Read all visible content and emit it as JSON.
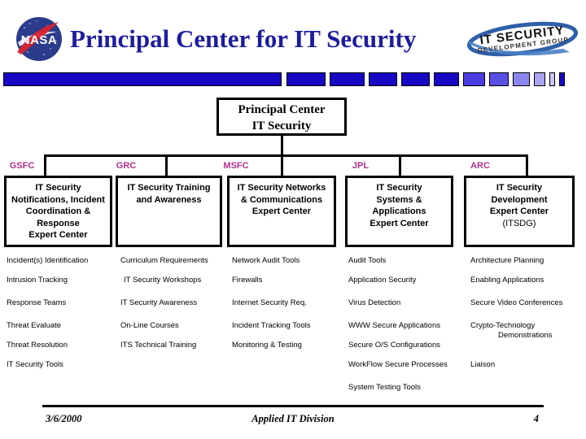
{
  "header": {
    "title": "Principal Center for IT Security",
    "title_color": "#1d1d9e",
    "nasa_logo_alt": "NASA",
    "itsdg_logo_line1": "IT SECURITY",
    "itsdg_logo_line2": "DEVELOPMENT GROUP"
  },
  "accent_bar": {
    "colors": [
      "#1708c4",
      "#1708c4",
      "#1708c4",
      "#1708c4",
      "#1708c4",
      "#1708c4",
      "#4a3ce0",
      "#5a4fe3",
      "#8b86ee",
      "#a9a5f3",
      "#c9c6f8",
      "#1708c4"
    ]
  },
  "chart": {
    "root": {
      "line1": "Principal Center",
      "line2": "IT Security"
    },
    "centers": [
      {
        "code": "GSFC",
        "unit_lines": [
          "IT Security",
          "Notifications, Incident",
          "Coordination &",
          "Response",
          "Expert Center"
        ],
        "unit_sub": "",
        "items": [
          "Incident(s) Identification",
          "Intrusion Tracking",
          "Response  Teams",
          "Threat Evaluate",
          "Threat Resolution",
          "IT Security Tools"
        ]
      },
      {
        "code": "GRC",
        "unit_lines": [
          "IT Security Training",
          "and Awareness"
        ],
        "unit_sub": "",
        "items": [
          "Curriculum Requirements",
          "IT Security Workshops",
          "IT Security Awareness",
          "On-Line Courses",
          "ITS Technical Training"
        ]
      },
      {
        "code": "MSFC",
        "unit_lines": [
          "IT Security Networks",
          "& Communications",
          "Expert Center"
        ],
        "unit_sub": "",
        "items": [
          "Network Audit Tools",
          "Firewalls",
          "Internet Security Req.",
          "Incident Tracking Tools",
          "Monitoring & Testing"
        ]
      },
      {
        "code": "JPL",
        "unit_lines": [
          "IT Security",
          "Systems &",
          "Applications",
          "Expert Center"
        ],
        "unit_sub": "",
        "items": [
          "Audit Tools",
          "Application Security",
          "Virus Detection",
          "WWW Secure Applications",
          "Secure O/S Configurations",
          "WorkFlow Secure Processes",
          "System Testing Tools"
        ]
      },
      {
        "code": "ARC",
        "unit_lines": [
          "IT Security",
          "Development",
          "Expert Center"
        ],
        "unit_sub": "(ITSDG)",
        "items": [
          "Architecture Planning",
          "Enabling Applications",
          "Secure Video Conferences",
          "Crypto-Technology",
          "Demonstrations",
          "Liaison"
        ]
      }
    ],
    "center_label_color": "#b0318a"
  },
  "footer": {
    "date": "3/6/2000",
    "division": "Applied IT Division",
    "page": "4"
  }
}
